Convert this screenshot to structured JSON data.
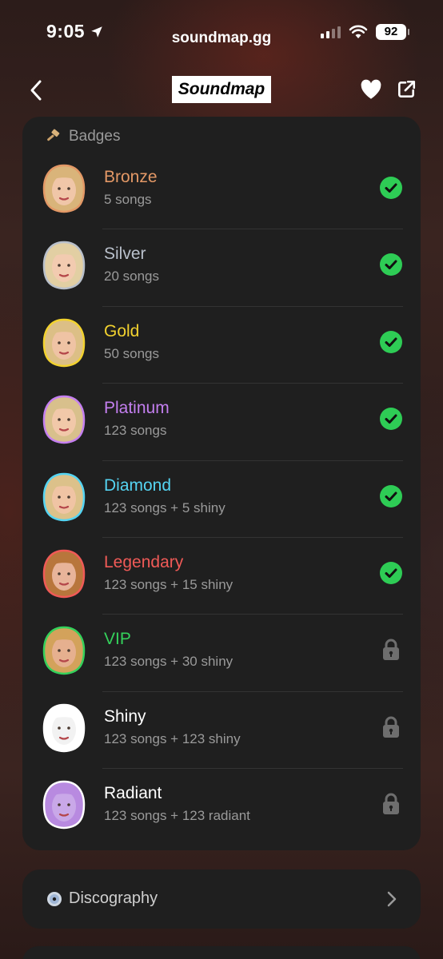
{
  "status_bar": {
    "time": "9:05",
    "url": "soundmap.gg",
    "battery": "92"
  },
  "nav": {
    "logo": "Soundmap"
  },
  "badges": {
    "header": "Badges",
    "items": [
      {
        "name": "Bronze",
        "sub": "5 songs",
        "color": "#e39866",
        "unlocked": true
      },
      {
        "name": "Silver",
        "sub": "20 songs",
        "color": "#b9c0cb",
        "unlocked": true
      },
      {
        "name": "Gold",
        "sub": "50 songs",
        "color": "#f2d22f",
        "unlocked": true
      },
      {
        "name": "Platinum",
        "sub": "123 songs",
        "color": "#c47ff0",
        "unlocked": true
      },
      {
        "name": "Diamond",
        "sub": "123 songs + 5 shiny",
        "color": "#55d4f2",
        "unlocked": true
      },
      {
        "name": "Legendary",
        "sub": "123 songs + 15 shiny",
        "color": "#f05a57",
        "unlocked": true
      },
      {
        "name": "VIP",
        "sub": "123 songs + 30 shiny",
        "color": "#34d15b",
        "unlocked": false
      },
      {
        "name": "Shiny",
        "sub": "123 songs + 123 shiny",
        "color": "#ffffff",
        "unlocked": false
      },
      {
        "name": "Radiant",
        "sub": "123 songs + 123 radiant",
        "color": "#ffffff",
        "unlocked": false
      }
    ]
  },
  "discography": {
    "label": "Discography"
  },
  "colors": {
    "check": "#2ecc55",
    "lock": "#6e6e6e",
    "card": "#1f1f1f"
  }
}
